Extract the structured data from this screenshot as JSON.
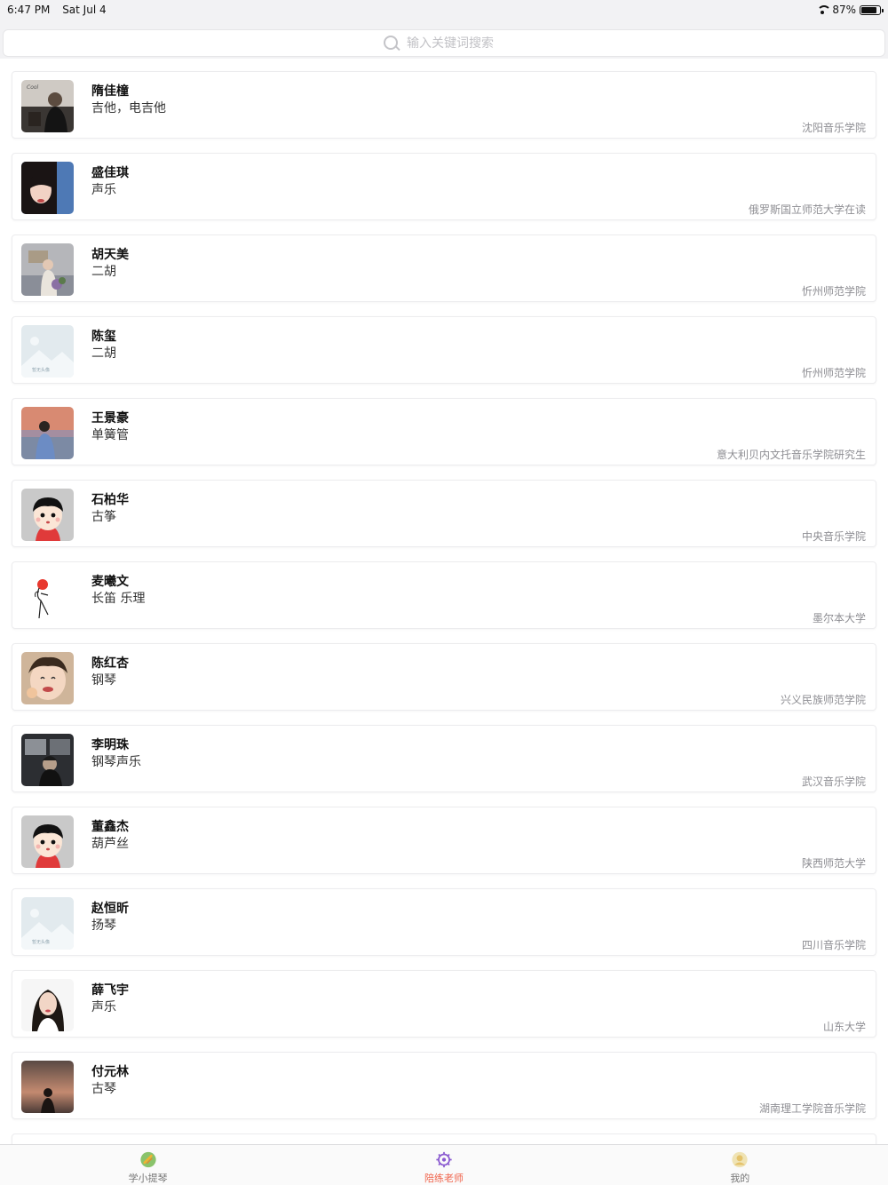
{
  "status_bar": {
    "time": "6:47 PM",
    "date": "Sat Jul 4",
    "battery": "87%"
  },
  "search": {
    "placeholder": "输入关键词搜索"
  },
  "teachers": [
    {
      "name": "隋佳橦",
      "subject": "吉他，电吉他",
      "school": "沈阳音乐学院",
      "avatar": "photo-dark-room"
    },
    {
      "name": "盛佳琪",
      "subject": "声乐",
      "school": "俄罗斯国立师范大学在读",
      "avatar": "photo-girl-portrait"
    },
    {
      "name": "胡天美",
      "subject": "二胡",
      "school": "忻州师范学院",
      "avatar": "photo-girl-flowers"
    },
    {
      "name": "陈玺",
      "subject": "二胡",
      "school": "忻州师范学院",
      "avatar": "placeholder-image"
    },
    {
      "name": "王景豪",
      "subject": "单簧管",
      "school": "意大利贝内文托音乐学院研究生",
      "avatar": "photo-sunset-person"
    },
    {
      "name": "石柏华",
      "subject": "古筝",
      "school": "中央音乐学院",
      "avatar": "cartoon-boy"
    },
    {
      "name": "麦曦文",
      "subject": "长笛 乐理",
      "school": "墨尔本大学",
      "avatar": "sketch-figure"
    },
    {
      "name": "陈红杏",
      "subject": "钢琴",
      "school": "兴义民族师范学院",
      "avatar": "photo-child"
    },
    {
      "name": "李明珠",
      "subject": "钢琴声乐",
      "school": "武汉音乐学院",
      "avatar": "photo-car-interior"
    },
    {
      "name": "董鑫杰",
      "subject": "葫芦丝",
      "school": "陕西师范大学",
      "avatar": "cartoon-boy"
    },
    {
      "name": "赵恒昕",
      "subject": "扬琴",
      "school": "四川音乐学院",
      "avatar": "placeholder-image"
    },
    {
      "name": "薛飞宇",
      "subject": "声乐",
      "school": "山东大学",
      "avatar": "photo-woman-portrait"
    },
    {
      "name": "付元林",
      "subject": "古琴",
      "school": "湖南理工学院音乐学院",
      "avatar": "photo-dusk-silhouette"
    }
  ],
  "tabs": [
    {
      "label": "学小提琴",
      "icon": "violin-icon",
      "active": false
    },
    {
      "label": "陪练老师",
      "icon": "teacher-icon",
      "active": true
    },
    {
      "label": "我的",
      "icon": "profile-icon",
      "active": false
    }
  ],
  "colors": {
    "accent": "#f0634b",
    "background": "#f2f2f4",
    "secondary_text": "#8e8e93"
  }
}
